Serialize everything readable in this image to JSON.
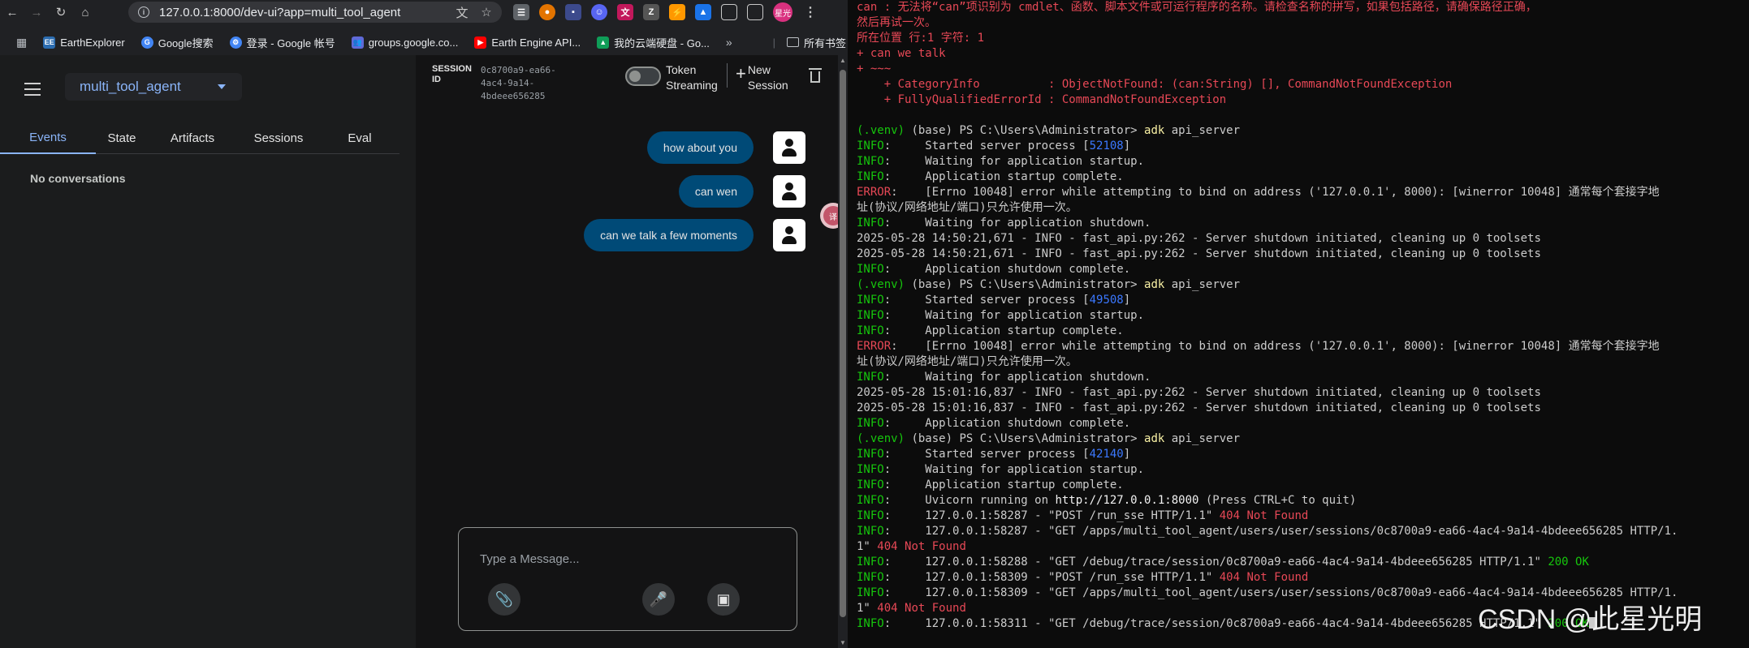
{
  "browser": {
    "url": "127.0.0.1:8000/dev-ui?app=multi_tool_agent",
    "profile_label": "星光",
    "bookmarks": [
      {
        "label": "EarthExplorer",
        "icon": "earthexplorer-icon",
        "color": "#2b6cb0"
      },
      {
        "label": "Google搜索",
        "icon": "google-icon",
        "color": "#4285f4"
      },
      {
        "label": "登录 - Google 帐号",
        "icon": "google-account-icon",
        "color": "#4285f4"
      },
      {
        "label": "groups.google.co...",
        "icon": "groups-icon",
        "color": "#5f6ad8"
      },
      {
        "label": "Earth Engine API...",
        "icon": "youtube-icon",
        "color": "#ff0000"
      },
      {
        "label": "我的云端硬盘 - Go...",
        "icon": "drive-icon",
        "color": "#0f9d58"
      }
    ],
    "all_bookmarks": "所有书签"
  },
  "app": {
    "agent_name": "multi_tool_agent",
    "tabs": [
      "Events",
      "State",
      "Artifacts",
      "Sessions",
      "Eval"
    ],
    "active_tab": "Events",
    "empty_text": "No conversations",
    "session": {
      "label_line1": "SESSION",
      "label_line2": "ID",
      "id_line1": "0c8700a9-ea66-4ac4-9a14-",
      "id_line2": "4bdeee656285"
    },
    "token_streaming_line1": "Token",
    "token_streaming_line2": "Streaming",
    "new_session_line1": "New",
    "new_session_line2": "Session",
    "messages": [
      "how about you",
      "can wen",
      "can we talk a few moments"
    ],
    "composer_placeholder": "Type a Message..."
  },
  "terminal": {
    "lines": [
      [
        {
          "t": "can : 无法将“can”项识别为 cmdlet、函数、脚本文件或可运行程序的名称。请检查名称的拼写，如果包括路径，请确保路径正确，",
          "c": "red"
        }
      ],
      [
        {
          "t": "然后再试一次。",
          "c": "red"
        }
      ],
      [
        {
          "t": "所在位置 行:1 字符: 1",
          "c": "red"
        }
      ],
      [
        {
          "t": "+ can we talk",
          "c": "red"
        }
      ],
      [
        {
          "t": "+ ~~~",
          "c": "red"
        }
      ],
      [
        {
          "t": "    + CategoryInfo          : ObjectNotFound: (can:String) [], CommandNotFoundException",
          "c": "red"
        }
      ],
      [
        {
          "t": "    + FullyQualifiedErrorId : CommandNotFoundException",
          "c": "red"
        }
      ],
      [
        {
          "t": "",
          "c": ""
        }
      ],
      [
        {
          "t": "(.venv)",
          "c": "green"
        },
        {
          "t": " (base) PS C:\\Users\\Administrator> ",
          "c": ""
        },
        {
          "t": "adk",
          "c": "yellow"
        },
        {
          "t": " api_server",
          "c": ""
        }
      ],
      [
        {
          "t": "INFO",
          "c": "green"
        },
        {
          "t": ":     Started server process [",
          "c": ""
        },
        {
          "t": "52108",
          "c": "blue"
        },
        {
          "t": "]",
          "c": ""
        }
      ],
      [
        {
          "t": "INFO",
          "c": "green"
        },
        {
          "t": ":     Waiting for application startup.",
          "c": ""
        }
      ],
      [
        {
          "t": "INFO",
          "c": "green"
        },
        {
          "t": ":     Application startup complete.",
          "c": ""
        }
      ],
      [
        {
          "t": "ERROR",
          "c": "red"
        },
        {
          "t": ":    [Errno 10048] error while attempting to bind on address ('127.0.0.1', 8000): [winerror 10048] 通常每个套接字地",
          "c": ""
        }
      ],
      [
        {
          "t": "址(协议/网络地址/端口)只允许使用一次。",
          "c": ""
        }
      ],
      [
        {
          "t": "INFO",
          "c": "green"
        },
        {
          "t": ":     Waiting for application shutdown.",
          "c": ""
        }
      ],
      [
        {
          "t": "2025-05-28 14:50:21,671 - INFO - fast_api.py:262 - Server shutdown initiated, cleaning up 0 toolsets",
          "c": ""
        }
      ],
      [
        {
          "t": "2025-05-28 14:50:21,671 - INFO - fast_api.py:262 - Server shutdown initiated, cleaning up 0 toolsets",
          "c": ""
        }
      ],
      [
        {
          "t": "INFO",
          "c": "green"
        },
        {
          "t": ":     Application shutdown complete.",
          "c": ""
        }
      ],
      [
        {
          "t": "(.venv)",
          "c": "green"
        },
        {
          "t": " (base) PS C:\\Users\\Administrator> ",
          "c": ""
        },
        {
          "t": "adk",
          "c": "yellow"
        },
        {
          "t": " api_server",
          "c": ""
        }
      ],
      [
        {
          "t": "INFO",
          "c": "green"
        },
        {
          "t": ":     Started server process [",
          "c": ""
        },
        {
          "t": "49508",
          "c": "blue"
        },
        {
          "t": "]",
          "c": ""
        }
      ],
      [
        {
          "t": "INFO",
          "c": "green"
        },
        {
          "t": ":     Waiting for application startup.",
          "c": ""
        }
      ],
      [
        {
          "t": "INFO",
          "c": "green"
        },
        {
          "t": ":     Application startup complete.",
          "c": ""
        }
      ],
      [
        {
          "t": "ERROR",
          "c": "red"
        },
        {
          "t": ":    [Errno 10048] error while attempting to bind on address ('127.0.0.1', 8000): [winerror 10048] 通常每个套接字地",
          "c": ""
        }
      ],
      [
        {
          "t": "址(协议/网络地址/端口)只允许使用一次。",
          "c": ""
        }
      ],
      [
        {
          "t": "INFO",
          "c": "green"
        },
        {
          "t": ":     Waiting for application shutdown.",
          "c": ""
        }
      ],
      [
        {
          "t": "2025-05-28 15:01:16,837 - INFO - fast_api.py:262 - Server shutdown initiated, cleaning up 0 toolsets",
          "c": ""
        }
      ],
      [
        {
          "t": "2025-05-28 15:01:16,837 - INFO - fast_api.py:262 - Server shutdown initiated, cleaning up 0 toolsets",
          "c": ""
        }
      ],
      [
        {
          "t": "INFO",
          "c": "green"
        },
        {
          "t": ":     Application shutdown complete.",
          "c": ""
        }
      ],
      [
        {
          "t": "(.venv)",
          "c": "green"
        },
        {
          "t": " (base) PS C:\\Users\\Administrator> ",
          "c": ""
        },
        {
          "t": "adk",
          "c": "yellow"
        },
        {
          "t": " api_server",
          "c": ""
        }
      ],
      [
        {
          "t": "INFO",
          "c": "green"
        },
        {
          "t": ":     Started server process [",
          "c": ""
        },
        {
          "t": "42140",
          "c": "blue"
        },
        {
          "t": "]",
          "c": ""
        }
      ],
      [
        {
          "t": "INFO",
          "c": "green"
        },
        {
          "t": ":     Waiting for application startup.",
          "c": ""
        }
      ],
      [
        {
          "t": "INFO",
          "c": "green"
        },
        {
          "t": ":     Application startup complete.",
          "c": ""
        }
      ],
      [
        {
          "t": "INFO",
          "c": "green"
        },
        {
          "t": ":     Uvicorn running on ",
          "c": ""
        },
        {
          "t": "http://127.0.0.1:8000",
          "c": "white"
        },
        {
          "t": " (Press CTRL+C to quit)",
          "c": ""
        }
      ],
      [
        {
          "t": "INFO",
          "c": "green"
        },
        {
          "t": ":     127.0.0.1:58287 - \"POST /run_sse HTTP/1.1\" ",
          "c": ""
        },
        {
          "t": "404 Not Found",
          "c": "red"
        }
      ],
      [
        {
          "t": "INFO",
          "c": "green"
        },
        {
          "t": ":     127.0.0.1:58287 - \"GET /apps/multi_tool_agent/users/user/sessions/0c8700a9-ea66-4ac4-9a14-4bdeee656285 HTTP/1.",
          "c": ""
        }
      ],
      [
        {
          "t": "1\" ",
          "c": ""
        },
        {
          "t": "404 Not Found",
          "c": "red"
        }
      ],
      [
        {
          "t": "INFO",
          "c": "green"
        },
        {
          "t": ":     127.0.0.1:58288 - \"GET /debug/trace/session/0c8700a9-ea66-4ac4-9a14-4bdeee656285 HTTP/1.1\" ",
          "c": ""
        },
        {
          "t": "200 OK",
          "c": "green"
        }
      ],
      [
        {
          "t": "INFO",
          "c": "green"
        },
        {
          "t": ":     127.0.0.1:58309 - \"POST /run_sse HTTP/1.1\" ",
          "c": ""
        },
        {
          "t": "404 Not Found",
          "c": "red"
        }
      ],
      [
        {
          "t": "INFO",
          "c": "green"
        },
        {
          "t": ":     127.0.0.1:58309 - \"GET /apps/multi_tool_agent/users/user/sessions/0c8700a9-ea66-4ac4-9a14-4bdeee656285 HTTP/1.",
          "c": ""
        }
      ],
      [
        {
          "t": "1\" ",
          "c": ""
        },
        {
          "t": "404 Not Found",
          "c": "red"
        }
      ],
      [
        {
          "t": "INFO",
          "c": "green"
        },
        {
          "t": ":     127.0.0.1:58311 - \"GET /debug/trace/session/0c8700a9-ea66-4ac4-9a14-4bdeee656285 HTTP/1.1\" ",
          "c": ""
        },
        {
          "t": "200 OK",
          "c": "green"
        }
      ]
    ]
  },
  "watermark": "CSDN @此星光明"
}
